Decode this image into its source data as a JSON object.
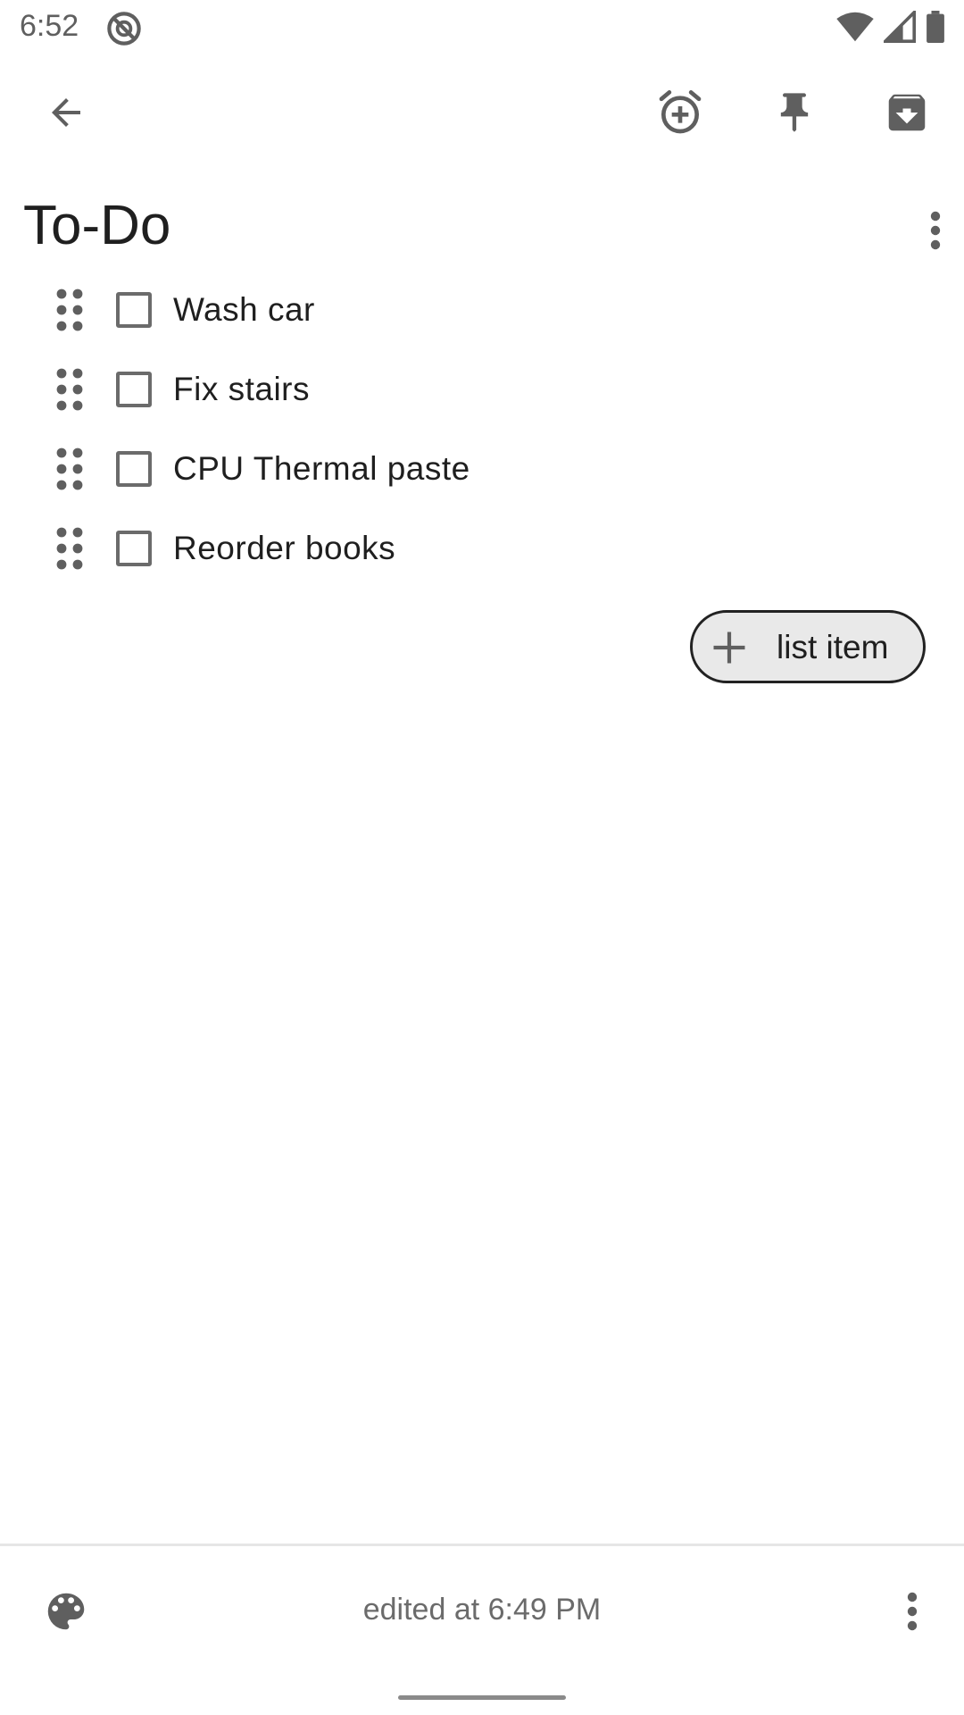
{
  "status_bar": {
    "time": "6:52",
    "icons": [
      "do-not-disturb-icon",
      "wifi-icon",
      "cellular-signal-icon",
      "battery-icon"
    ]
  },
  "toolbar": {
    "back_icon": "back-arrow-icon",
    "actions": [
      "add-reminder-icon",
      "pin-icon",
      "archive-icon"
    ]
  },
  "note": {
    "title": "To-Do",
    "items": [
      {
        "text": "Wash car",
        "checked": false
      },
      {
        "text": "Fix stairs",
        "checked": false
      },
      {
        "text": "CPU Thermal paste",
        "checked": false
      },
      {
        "text": "Reorder books",
        "checked": false
      }
    ],
    "add_button_label": "list item"
  },
  "bottom_bar": {
    "edited_text": "edited at 6:49 PM",
    "left_icon": "palette-icon",
    "right_icon": "more-vert-icon"
  },
  "colors": {
    "icon": "#5f5f5f",
    "text": "#1f1f1f",
    "secondary_text": "#6b6b6b",
    "add_button_bg": "#e9e9e9"
  }
}
